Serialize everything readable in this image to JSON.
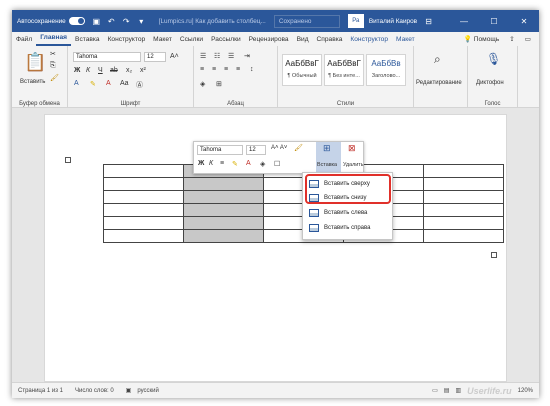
{
  "titlebar": {
    "autosave": "Автосохранение",
    "doc_title": "[Lumpics.ru] Как добавить столбец...",
    "find": "Сохранено",
    "initials": "Ра",
    "user": "Виталий Каиров",
    "btn_min": "—",
    "btn_max": "☐",
    "btn_close": "✕"
  },
  "tabs": [
    "Файл",
    "Главная",
    "Вставка",
    "Конструктор",
    "Макет",
    "Ссылки",
    "Рассылки",
    "Рецензирова",
    "Вид",
    "Справка",
    "Конструктор",
    "Макет"
  ],
  "tabs_right": {
    "help": "Помощь"
  },
  "ribbon": {
    "clipboard": {
      "paste": "Вставить",
      "label": "Буфер обмена"
    },
    "font": {
      "name": "Tahoma",
      "size": "12",
      "label": "Шрифт"
    },
    "paragraph": {
      "label": "Абзац"
    },
    "styles": {
      "items": [
        {
          "sample": "АаБбВвГ",
          "name": "¶ Обычный"
        },
        {
          "sample": "АаБбВвГ",
          "name": "¶ Без инте..."
        },
        {
          "sample": "АаБбВв",
          "name": "Заголово..."
        }
      ],
      "label": "Стили"
    },
    "editing": {
      "label": "Редактирование"
    },
    "voice": {
      "dictation": "Диктофон",
      "label": "Голос"
    }
  },
  "minibar": {
    "font": "Tahoma",
    "size": "12",
    "insert": "Вставка",
    "delete": "Удалить"
  },
  "menu": {
    "items": [
      "Вставить сверху",
      "Вставить снизу",
      "Вставить слева",
      "Вставить справа"
    ]
  },
  "status": {
    "page": "Страница 1 из 1",
    "words": "Число слов: 0",
    "lang": "русский",
    "zoom": "120%"
  },
  "watermark": "Userlife.ru"
}
